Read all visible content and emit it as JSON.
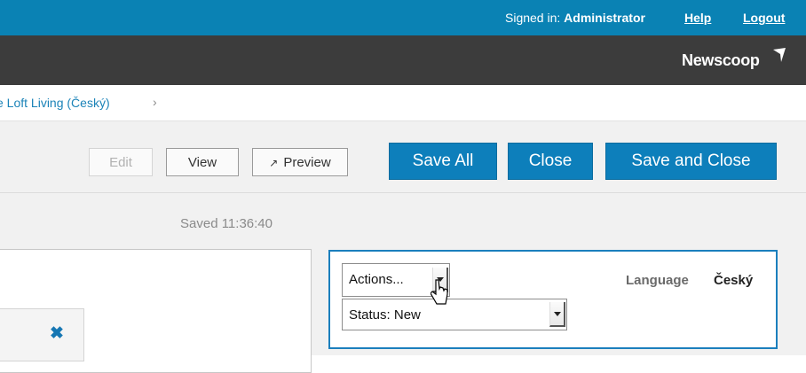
{
  "topbar": {
    "signed_prefix": "Signed in:",
    "user": "Administrator",
    "help": "Help",
    "logout": "Logout"
  },
  "brand": {
    "name": "Newscoop",
    "mark_icon": "newscoop-arrow-icon"
  },
  "breadcrumb": {
    "item": "e Loft Living (Český)",
    "separator": "›"
  },
  "toolbar": {
    "edit": "Edit",
    "view": "View",
    "preview": "Preview",
    "save_all": "Save All",
    "close": "Close",
    "save_and_close": "Save and Close"
  },
  "status": {
    "saved": "Saved 11:36:40"
  },
  "panel": {
    "actions_select": "Actions...",
    "status_select": "Status: New",
    "language_label": "Language",
    "language_value": "Český"
  },
  "colors": {
    "topbar": "#0a82b4",
    "brandbar": "#3c3c3c",
    "primary_button": "#0d7fbb",
    "panel_border": "#1b7fbd"
  }
}
